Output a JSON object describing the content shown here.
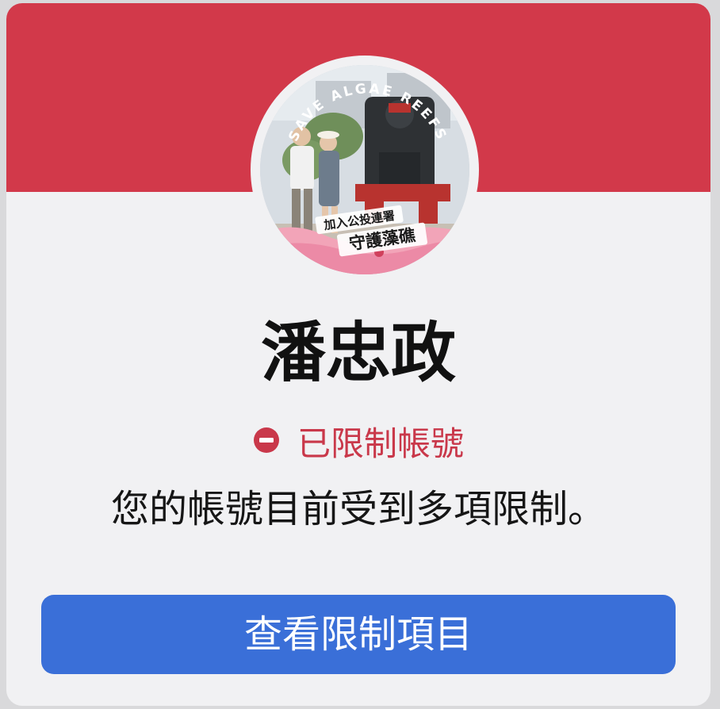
{
  "profile": {
    "name": "潘忠政",
    "avatar": {
      "icon": "profile-photo",
      "arc_text": "SAVE ALGAE REEFS",
      "caption_line1": "加入公投連署",
      "caption_line2": "守護藻礁"
    }
  },
  "status": {
    "icon": "stop-circle-icon",
    "label": "已限制帳號",
    "color": "#c9384a"
  },
  "message": "您的帳號目前受到多項限制。",
  "actions": {
    "view_restrictions_label": "查看限制項目"
  },
  "theme": {
    "banner_color": "#d2394a",
    "card_background": "#f1f1f3",
    "button_color": "#3a6fd8"
  }
}
